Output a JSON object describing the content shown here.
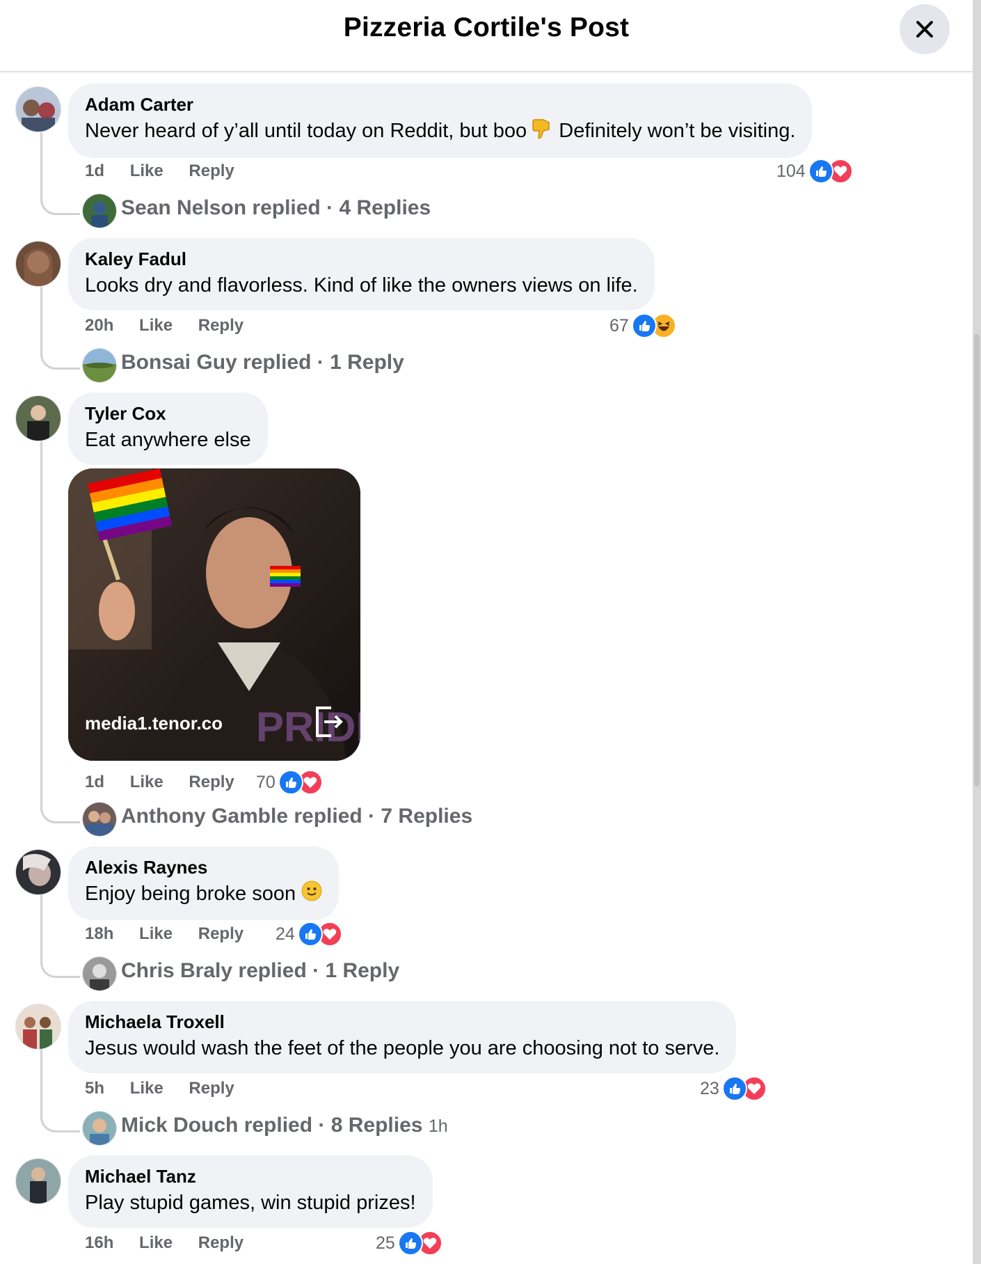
{
  "header": {
    "title": "Pizzeria Cortile's Post"
  },
  "actions": {
    "like": "Like",
    "reply": "Reply"
  },
  "comments": [
    {
      "author": "Adam Carter",
      "text_before": "Never heard of y’all until today on Reddit, but boo",
      "emoji_icon": "thumbs-down-emoji",
      "text_after": "Definitely won’t be visiting.",
      "time": "1d",
      "reaction_count": "104",
      "reactions": [
        "like",
        "love"
      ],
      "reply_summary": {
        "name": "Sean Nelson replied",
        "count": "4 Replies"
      }
    },
    {
      "author": "Kaley Fadul",
      "text": "Looks dry and flavorless. Kind of like the owners views on life.",
      "time": "20h",
      "reaction_count": "67",
      "reactions": [
        "like",
        "haha"
      ],
      "reply_summary": {
        "name": "Bonsai Guy replied",
        "count": "1 Reply"
      }
    },
    {
      "author": "Tyler Cox",
      "text": "Eat anywhere else",
      "gif": {
        "caption": "media1.tenor.co",
        "watermark": "PRIDE"
      },
      "time": "1d",
      "reaction_count": "70",
      "reactions": [
        "like",
        "love"
      ],
      "reply_summary": {
        "name": "Anthony Gamble replied",
        "count": "7 Replies"
      }
    },
    {
      "author": "Alexis Raynes",
      "text": "Enjoy being broke soon",
      "emoji_icon": "slightly-smiling-face-emoji",
      "time": "18h",
      "reaction_count": "24",
      "reactions": [
        "like",
        "love"
      ],
      "reply_summary": {
        "name": "Chris Braly replied",
        "count": "1 Reply"
      }
    },
    {
      "author": "Michaela Troxell",
      "text": "Jesus would wash the feet of the people you are choosing not to serve.",
      "time": "5h",
      "reaction_count": "23",
      "reactions": [
        "like",
        "love"
      ],
      "reply_summary": {
        "name": "Mick Douch replied",
        "count": "8 Replies",
        "time": "1h"
      }
    },
    {
      "author": "Michael Tanz",
      "text": "Play stupid games, win stupid prizes!",
      "time": "16h",
      "reaction_count": "25",
      "reactions": [
        "like",
        "love"
      ]
    }
  ],
  "colors": {
    "like": "#1877f2",
    "love": "#f33e58",
    "haha": "#f7b125",
    "bubble": "#f0f2f5",
    "meta": "#65676b"
  }
}
